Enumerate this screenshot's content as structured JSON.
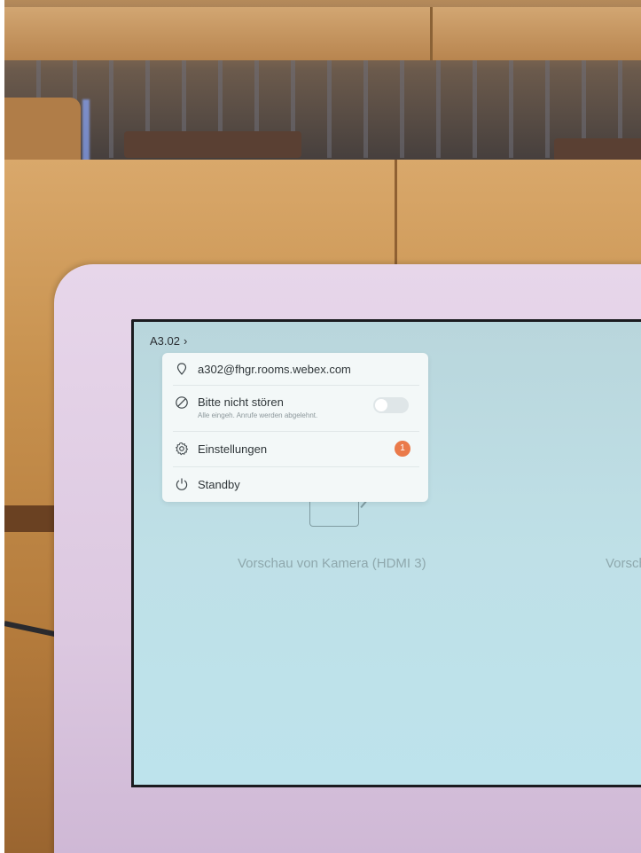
{
  "screen": {
    "room_title": "A3.02",
    "chevron": "›",
    "preview_label": "Vorschau von Kamera (HDMI 3)",
    "preview_label_cut": "Vorsch"
  },
  "menu": {
    "address": {
      "icon": "location-pin-icon",
      "label": "a302@fhgr.rooms.webex.com"
    },
    "dnd": {
      "icon": "block-icon",
      "label": "Bitte nicht stören",
      "sublabel": "Alle eingeh. Anrufe werden abgelehnt.",
      "enabled": false
    },
    "settings": {
      "icon": "gear-icon",
      "label": "Einstellungen",
      "badge": "1"
    },
    "standby": {
      "icon": "power-icon",
      "label": "Standby"
    }
  },
  "colors": {
    "screen_bg": "#bfe0e7",
    "menu_bg": "#f3f8f8",
    "badge": "#ea7a4a",
    "bezel": "#dcc8e0"
  }
}
